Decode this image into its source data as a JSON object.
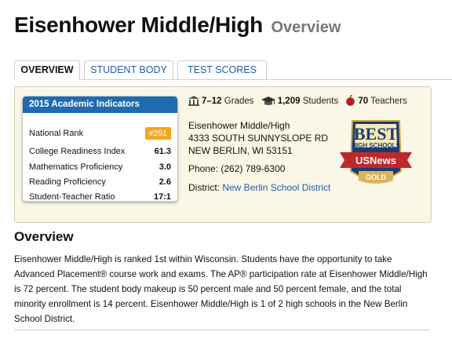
{
  "page": {
    "title": "Eisenhower Middle/High",
    "subtitle": "Overview"
  },
  "tabs": [
    {
      "label": "OVERVIEW",
      "active": true
    },
    {
      "label": "STUDENT BODY",
      "active": false
    },
    {
      "label": "TEST SCORES",
      "active": false
    }
  ],
  "indicators": {
    "heading": "2015 Academic Indicators",
    "rows": [
      {
        "label": "National Rank",
        "value": "#291"
      },
      {
        "label": "College Readiness Index",
        "value": "61.3"
      },
      {
        "label": "Mathematics Proficiency",
        "value": "3.0"
      },
      {
        "label": "Reading Proficiency",
        "value": "2.6"
      },
      {
        "label": "Student-Teacher Ratio",
        "value": "17:1"
      }
    ]
  },
  "stats": {
    "grades": "7–12",
    "grades_label": "Grades",
    "students": "1,209",
    "students_label": "Students",
    "teachers": "70",
    "teachers_label": "Teachers"
  },
  "address": {
    "name": "Eisenhower Middle/High",
    "street": "4333 SOUTH SUNNYSLOPE RD",
    "city": "NEW BERLIN, WI 53151",
    "phone": "Phone: (262) 789-6300",
    "district_label": "District:",
    "district_link": "New Berlin School District"
  },
  "badge": {
    "line1": "BEST",
    "line2": "HIGH SCHOOLS",
    "brand": "USNews",
    "level": "GOLD"
  },
  "overview": {
    "heading": "Overview",
    "body": "Eisenhower Middle/High is ranked 1st within Wisconsin. Students have the opportunity to take Advanced Placement® course work and exams. The AP® participation rate at Eisenhower Middle/High is 72 percent. The student body makeup is 50 percent male and 50 percent female, and the total minority enrollment is 14 percent. Eisenhower Middle/High is 1 of 2 high schools in the New Berlin School District."
  },
  "colors": {
    "accent_blue": "#1c6bb3",
    "link_blue": "#1e5ea8",
    "rank_orange": "#f4a623",
    "panel_bg": "#fbf7e6"
  }
}
